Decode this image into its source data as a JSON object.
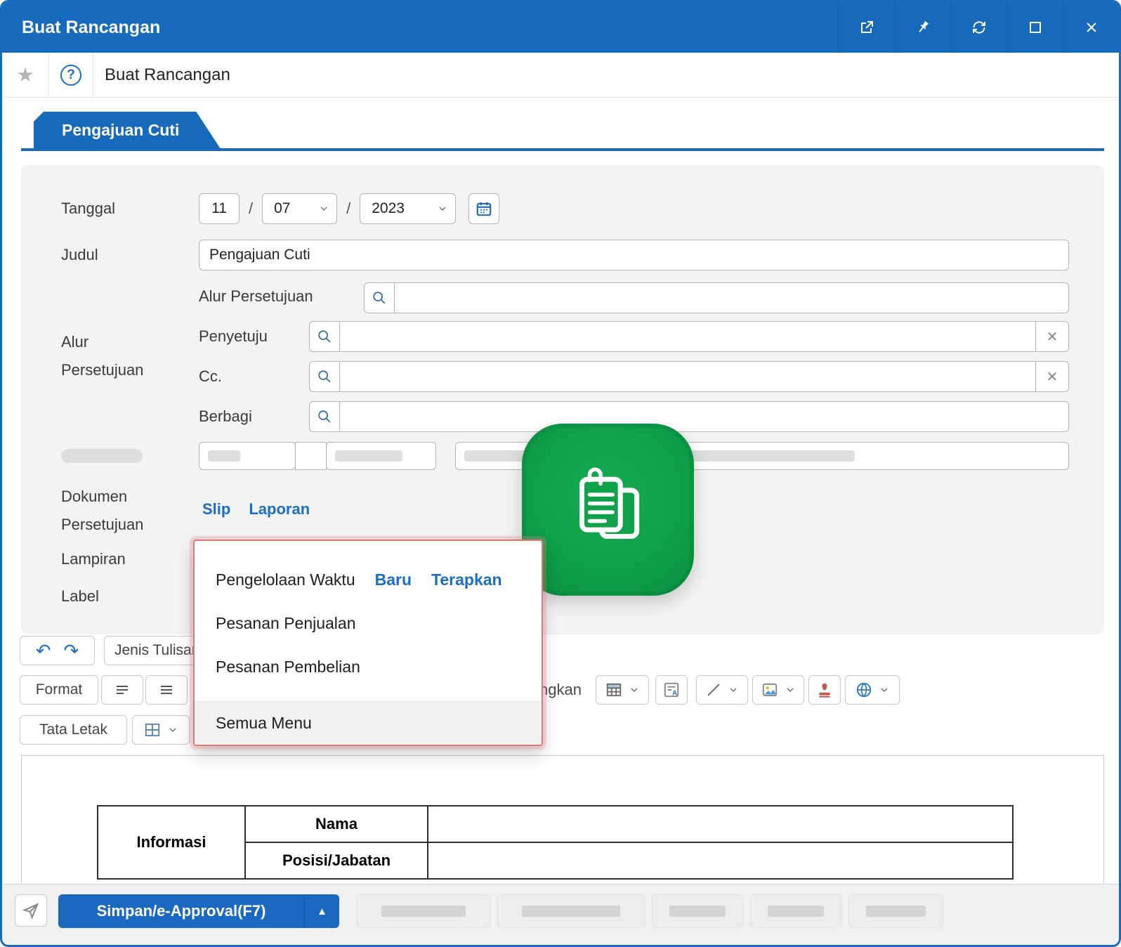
{
  "window": {
    "title": "Buat Rancangan"
  },
  "toolbar": {
    "breadcrumb": "Buat Rancangan",
    "star": "★",
    "help": "?"
  },
  "tab": {
    "label": "Pengajuan Cuti"
  },
  "form": {
    "tanggal": {
      "label": "Tanggal",
      "day": "11",
      "month": "07",
      "year": "2023",
      "separator": "/"
    },
    "judul": {
      "label": "Judul",
      "value": "Pengajuan Cuti"
    },
    "alur_inline_label": "Alur Persetujuan",
    "alur_group": {
      "line1": "Alur",
      "line2": "Persetujuan",
      "penyetuju": "Penyetuju",
      "cc": "Cc.",
      "berbagi": "Berbagi",
      "clear": "✕"
    },
    "dokumen": {
      "line1": "Dokumen",
      "line2": "Persetujuan",
      "links": [
        {
          "label": "Slip"
        },
        {
          "label": "Laporan"
        }
      ]
    },
    "lampiran_label": "Lampiran",
    "label_label": "Label"
  },
  "menu": {
    "items": [
      {
        "label": "Pengelolaan Waktu",
        "action1": "Baru",
        "action2": "Terapkan"
      },
      {
        "label": "Pesanan Penjualan"
      },
      {
        "label": "Pesanan Pembelian"
      },
      {
        "label": "Semua Menu"
      }
    ]
  },
  "editor": {
    "undo": "↶",
    "redo": "↷",
    "jenis_tulisan": "Jenis Tulisan",
    "format": "Format",
    "gabungkan": "Gabungkan",
    "tata_letak": "Tata Letak"
  },
  "document": {
    "table": {
      "informasi": "Informasi",
      "row1": "Nama",
      "row2": "Posisi/Jabatan"
    }
  },
  "footer": {
    "save": "Simpan/e-Approval(F7)",
    "caret": "▲"
  },
  "colors": {
    "titlebar": "#1669bb",
    "link": "#1a6fc4",
    "green_icon": "#0fa04a",
    "menu_border": "#d97b76"
  }
}
